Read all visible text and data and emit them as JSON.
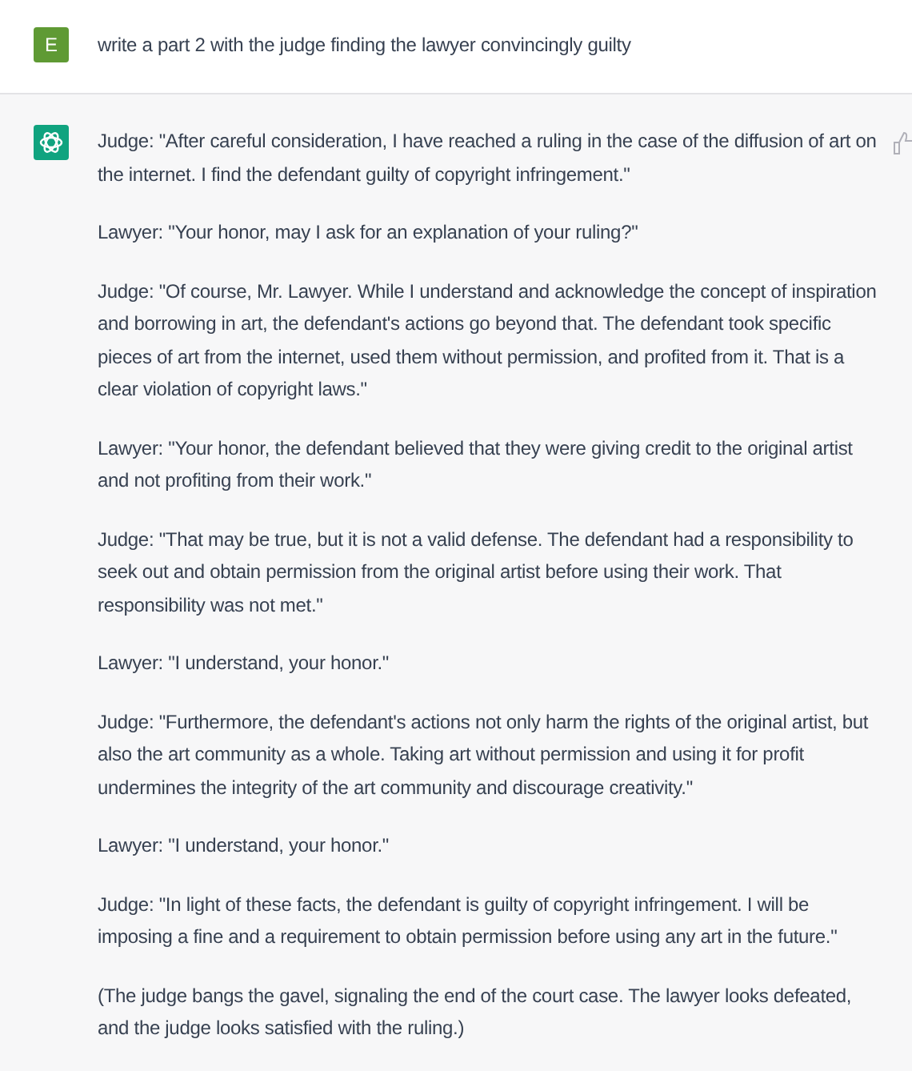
{
  "user_message": {
    "avatar_letter": "E",
    "text": "write a part 2 with the judge finding the lawyer convincingly guilty"
  },
  "assistant_message": {
    "paragraphs": [
      "Judge: \"After careful consideration, I have reached a ruling in the case of the diffusion of art on the internet. I find the defendant guilty of copyright infringement.\"",
      "Lawyer: \"Your honor, may I ask for an explanation of your ruling?\"",
      "Judge: \"Of course, Mr. Lawyer. While I understand and acknowledge the concept of inspiration and borrowing in art, the defendant's actions go beyond that. The defendant took specific pieces of art from the internet, used them without permission, and profited from it. That is a clear violation of copyright laws.\"",
      "Lawyer: \"Your honor, the defendant believed that they were giving credit to the original artist and not profiting from their work.\"",
      "Judge: \"That may be true, but it is not a valid defense. The defendant had a responsibility to seek out and obtain permission from the original artist before using their work. That responsibility was not met.\"",
      "Lawyer: \"I understand, your honor.\"",
      "Judge: \"Furthermore, the defendant's actions not only harm the rights of the original artist, but also the art community as a whole. Taking art without permission and using it for profit undermines the integrity of the art community and discourage creativity.\"",
      "Lawyer: \"I understand, your honor.\"",
      "Judge: \"In light of these facts, the defendant is guilty of copyright infringement. I will be imposing a fine and a requirement to obtain permission before using any art in the future.\"",
      "(The judge bangs the gavel, signaling the end of the court case. The lawyer looks defeated, and the judge looks satisfied with the ruling.)"
    ]
  }
}
